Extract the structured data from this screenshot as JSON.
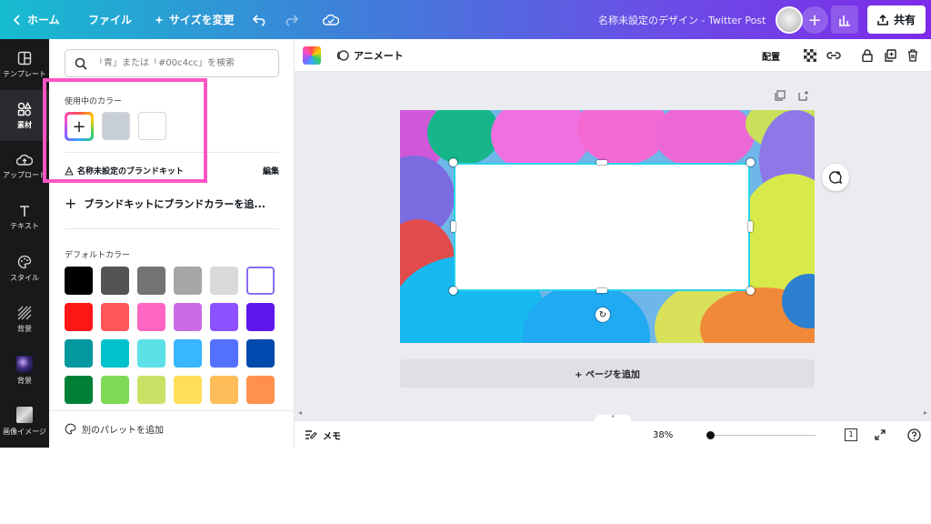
{
  "topbar": {
    "home": "ホーム",
    "file": "ファイル",
    "resize": "サイズを変更",
    "doc_title": "名称未設定のデザイン - Twitter Post",
    "share": "共有"
  },
  "rail": {
    "items": [
      {
        "label": "テンプレート",
        "icon": "template-icon"
      },
      {
        "label": "素材",
        "icon": "elements-icon"
      },
      {
        "label": "アップロード",
        "icon": "upload-icon"
      },
      {
        "label": "テキスト",
        "icon": "text-icon"
      },
      {
        "label": "スタイル",
        "icon": "palette-icon"
      },
      {
        "label": "背景",
        "icon": "background-icon"
      },
      {
        "label": "背景",
        "icon": "background-image-icon"
      },
      {
        "label": "画像イメージ",
        "icon": "image-icon"
      }
    ]
  },
  "panel": {
    "search_placeholder": "「青」または「#00c4cc」を検索",
    "in_use_title": "使用中のカラー",
    "in_use_colors": [
      "#c9cfd8",
      "#ffffff"
    ],
    "brandkit_title": "名称未設定のブランドキット",
    "edit": "編集",
    "add_brand_color": "ブランドキットにブランドカラーを追...",
    "default_title": "デフォルトカラー",
    "default_colors": [
      "#000000",
      "#545454",
      "#737373",
      "#a6a6a6",
      "#d9d9d9",
      "#ffffff",
      "#ff1616",
      "#ff5757",
      "#ff66c4",
      "#cb6ce6",
      "#8c52ff",
      "#5e17eb",
      "#03989e",
      "#00c2cb",
      "#5ce1e6",
      "#38b6ff",
      "#5271ff",
      "#004aad",
      "#008037",
      "#7ed957",
      "#c9e265",
      "#ffde59",
      "#ffbd59",
      "#ff914d"
    ],
    "add_palette": "別のパレットを追加"
  },
  "toolbar": {
    "animate": "アニメート",
    "position": "配置"
  },
  "canvas": {
    "add_page": "+ ページを追加"
  },
  "bottom": {
    "notes": "メモ",
    "zoom": "38%",
    "page_count": "1"
  },
  "colors": {
    "highlight": "#ff55c4",
    "selection": "#2ad4e8"
  }
}
